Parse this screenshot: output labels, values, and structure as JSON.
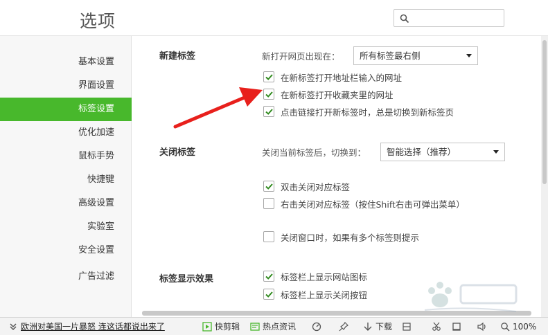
{
  "header": {
    "title": "选项",
    "search_placeholder": ""
  },
  "sidebar": {
    "items": [
      {
        "label": "基本设置"
      },
      {
        "label": "界面设置"
      },
      {
        "label": "标签设置"
      },
      {
        "label": "优化加速"
      },
      {
        "label": "鼠标手势"
      },
      {
        "label": "快捷键"
      },
      {
        "label": "高级设置"
      },
      {
        "label": "实验室"
      },
      {
        "label": "安全设置"
      },
      {
        "label": "广告过滤"
      }
    ],
    "active_index": 2
  },
  "new_tab": {
    "title": "新建标签",
    "open_label": "新打开网页出现在：",
    "open_select": "所有标签最右侧",
    "options": [
      {
        "label": "在新标签打开地址栏输入的网址",
        "checked": true
      },
      {
        "label": "在新标签打开收藏夹里的网址",
        "checked": true
      },
      {
        "label": "点击链接打开新标签时，总是切换到新标签页",
        "checked": true
      }
    ]
  },
  "close_tab": {
    "title": "关闭标签",
    "switch_label": "关闭当前标签后，切换到：",
    "switch_select": "智能选择（推荐）",
    "options": [
      {
        "label": "双击关闭对应标签",
        "checked": true
      },
      {
        "label": "右击关闭对应标签（按住Shift右击可弹出菜单）",
        "checked": false
      },
      {
        "label": "关闭窗口时，如果有多个标签则提示",
        "checked": false
      }
    ]
  },
  "tab_display": {
    "title": "标签显示效果",
    "options": [
      {
        "label": "标签栏上显示网站图标",
        "checked": true
      },
      {
        "label": "标签栏上显示关闭按钮",
        "checked": true
      }
    ]
  },
  "statusbar": {
    "news": "欧洲对美国一片暴怒 连这话都说出来了",
    "quick_edit": "快剪辑",
    "hot_news": "热点资讯",
    "download": "下载",
    "zoom": "100%"
  },
  "colors": {
    "accent": "#48b82c",
    "annotation": "#e8201c"
  }
}
